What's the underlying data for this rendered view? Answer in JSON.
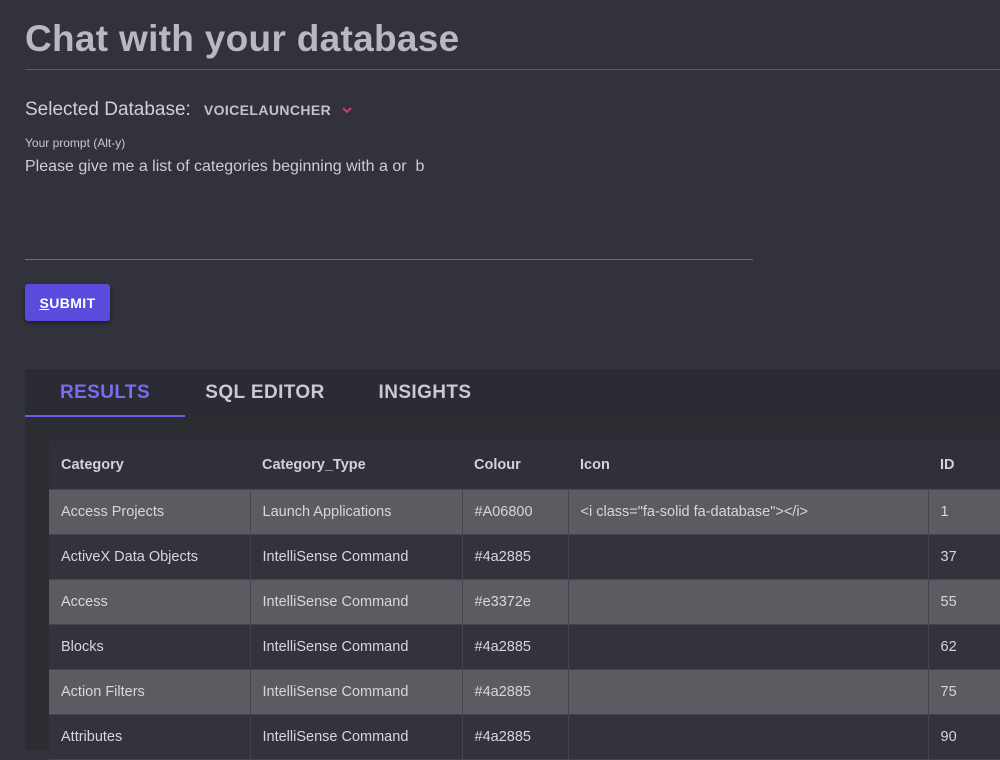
{
  "page": {
    "title": "Chat with your database"
  },
  "database": {
    "label": "Selected Database:",
    "value": "VOICELAUNCHER",
    "chevron_icon": "chevron-down-icon",
    "chevron_color": "#e0397a"
  },
  "prompt": {
    "label": "Your prompt (Alt-y)",
    "value": "Please give me a list of categories beginning with a or  b"
  },
  "submit": {
    "label_underlined": "S",
    "label_rest": "UBMIT",
    "color": "#5b4bdc"
  },
  "tabs": [
    {
      "label": "RESULTS",
      "active": true
    },
    {
      "label": "SQL EDITOR",
      "active": false
    },
    {
      "label": "INSIGHTS",
      "active": false
    }
  ],
  "accent": "#6b5be8",
  "table": {
    "columns": [
      "Category",
      "Category_Type",
      "Colour",
      "Icon",
      "ID"
    ],
    "rows": [
      [
        "Access Projects",
        "Launch Applications",
        "#A06800",
        "<i class=\"fa-solid fa-database\"></i>",
        "1"
      ],
      [
        "ActiveX Data Objects",
        "IntelliSense Command",
        "#4a2885",
        "",
        "37"
      ],
      [
        "Access",
        "IntelliSense Command",
        "#e3372e",
        "",
        "55"
      ],
      [
        "Blocks",
        "IntelliSense Command",
        "#4a2885",
        "",
        "62"
      ],
      [
        "Action Filters",
        "IntelliSense Command",
        "#4a2885",
        "",
        "75"
      ],
      [
        "Attributes",
        "IntelliSense Command",
        "#4a2885",
        "",
        "90"
      ]
    ]
  }
}
